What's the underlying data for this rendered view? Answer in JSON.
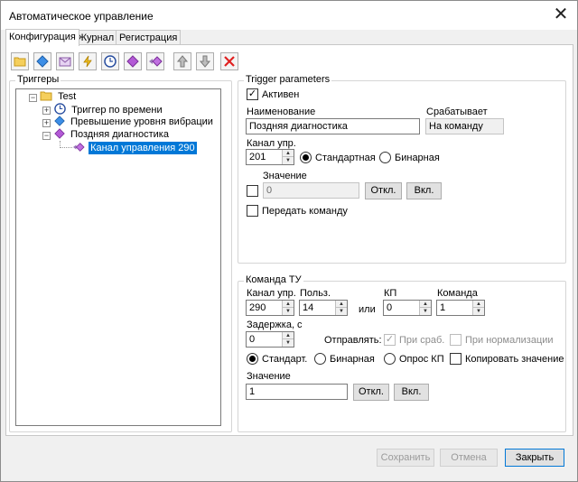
{
  "window": {
    "title": "Автоматическое управление"
  },
  "tabs": [
    {
      "label": "Конфигурация",
      "active": true
    },
    {
      "label": "Журнал",
      "active": false
    },
    {
      "label": "Регистрация",
      "active": false
    }
  ],
  "toolbar": {
    "icons": [
      "new-folder-icon",
      "blue-diamond-icon",
      "envelope-icon",
      "lightning-icon",
      "clock-icon",
      "purple-diamond-icon",
      "purple-diamond-arrow-icon",
      "move-up-icon",
      "move-down-icon",
      "delete-icon"
    ]
  },
  "triggers": {
    "group_label": "Триггеры",
    "root": "Test",
    "items": [
      {
        "label": "Триггер по времени",
        "icon": "clock-icon"
      },
      {
        "label": "Превышение уровня вибрации",
        "icon": "blue-diamond-icon"
      },
      {
        "label": "Поздняя диагностика",
        "icon": "purple-diamond-icon"
      }
    ],
    "child": {
      "label": "Канал управления 290",
      "selected": true
    }
  },
  "trigger_params": {
    "group_label": "Trigger parameters",
    "active_label": "Активен",
    "active_checked": true,
    "name_label": "Наименование",
    "name_value": "Поздняя диагностика",
    "fires_label": "Срабатывает",
    "fires_value": "На команду",
    "channel_label": "Канал упр.",
    "channel_value": "201",
    "radio_standard": "Стандартная",
    "radio_binary": "Бинарная",
    "value_label": "Значение",
    "value_value": "0",
    "off_button": "Откл.",
    "on_button": "Вкл.",
    "send_command_label": "Передать команду"
  },
  "command_tu": {
    "group_label": "Команда ТУ",
    "channel_label": "Канал упр.",
    "channel_value": "290",
    "user_label": "Польз.",
    "user_value": "14",
    "or_label": "или",
    "kp_label": "КП",
    "kp_value": "0",
    "command_label": "Команда",
    "command_value": "1",
    "delay_label": "Задержка, с",
    "delay_value": "0",
    "send_label": "Отправлять:",
    "on_fire_label": "При сраб.",
    "on_normal_label": "При нормализации",
    "radio_standard": "Стандарт.",
    "radio_binary": "Бинарная",
    "radio_poll": "Опрос КП",
    "copy_value_label": "Копировать значение",
    "value_label": "Значение",
    "value_value": "1",
    "off_button": "Откл.",
    "on_button": "Вкл."
  },
  "footer": {
    "save_label": "Сохранить",
    "cancel_label": "Отмена",
    "close_label": "Закрыть"
  }
}
